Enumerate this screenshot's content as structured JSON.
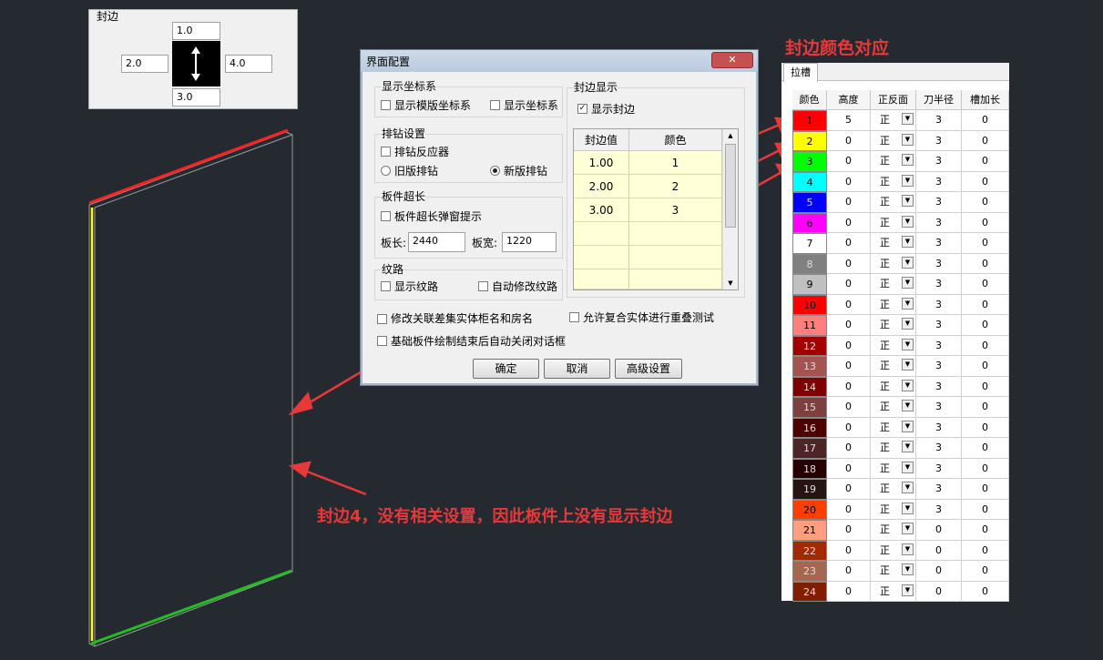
{
  "edge_panel": {
    "title": "封边",
    "top": "1.0",
    "left": "2.0",
    "right": "4.0",
    "bottom": "3.0"
  },
  "dialog": {
    "title": "界面配置",
    "close_label": "✕",
    "coord_group": "显示坐标系",
    "coord_opt1": "显示模版坐标系",
    "coord_opt2": "显示坐标系",
    "drill_group": "排钻设置",
    "drill_reactor": "排钻反应器",
    "drill_old": "旧版排钻",
    "drill_new": "新版排钻",
    "overlen_group": "板件超长",
    "overlen_popup": "板件超长弹窗提示",
    "len_label": "板长:",
    "len_value": "2440",
    "width_label": "板宽:",
    "width_value": "1220",
    "grain_group": "纹路",
    "grain_show": "显示纹路",
    "grain_auto": "自动修改纹路",
    "edge_group": "封边显示",
    "edge_show": "显示封边",
    "edge_table": {
      "headers": [
        "封边值",
        "颜色"
      ],
      "rows": [
        [
          "1.00",
          "1"
        ],
        [
          "2.00",
          "2"
        ],
        [
          "3.00",
          "3"
        ]
      ]
    },
    "opt_rename": "修改关联差集实体柜名和房名",
    "opt_overlap": "允许复合实体进行重叠测试",
    "opt_autoclose": "基础板件绘制结束后自动关闭对话框",
    "ok": "确定",
    "cancel": "取消",
    "advanced": "高级设置"
  },
  "color_panel": {
    "title": "封边颜色对应",
    "tab": "拉槽",
    "headers": [
      "颜色",
      "高度",
      "正反面",
      "刀半径",
      "槽加长"
    ],
    "face_value": "正",
    "rows": [
      {
        "id": "1",
        "color": "#ff0000",
        "height": "5",
        "radius": "3",
        "ext": "0"
      },
      {
        "id": "2",
        "color": "#ffff00",
        "height": "0",
        "radius": "3",
        "ext": "0"
      },
      {
        "id": "3",
        "color": "#00ff00",
        "height": "0",
        "radius": "3",
        "ext": "0"
      },
      {
        "id": "4",
        "color": "#00ffff",
        "height": "0",
        "radius": "3",
        "ext": "0"
      },
      {
        "id": "5",
        "color": "#0000ff",
        "height": "0",
        "radius": "3",
        "ext": "0"
      },
      {
        "id": "6",
        "color": "#ff00ff",
        "height": "0",
        "radius": "3",
        "ext": "0"
      },
      {
        "id": "7",
        "color": "#ffffff",
        "height": "0",
        "radius": "3",
        "ext": "0"
      },
      {
        "id": "8",
        "color": "#808080",
        "height": "0",
        "radius": "3",
        "ext": "0"
      },
      {
        "id": "9",
        "color": "#c0c0c0",
        "height": "0",
        "radius": "3",
        "ext": "0"
      },
      {
        "id": "10",
        "color": "#ff0000",
        "height": "0",
        "radius": "3",
        "ext": "0"
      },
      {
        "id": "11",
        "color": "#ff7f7f",
        "height": "0",
        "radius": "3",
        "ext": "0"
      },
      {
        "id": "12",
        "color": "#a50000",
        "height": "0",
        "radius": "3",
        "ext": "0"
      },
      {
        "id": "13",
        "color": "#a55252",
        "height": "0",
        "radius": "3",
        "ext": "0"
      },
      {
        "id": "14",
        "color": "#7f0000",
        "height": "0",
        "radius": "3",
        "ext": "0"
      },
      {
        "id": "15",
        "color": "#7f3f3f",
        "height": "0",
        "radius": "3",
        "ext": "0"
      },
      {
        "id": "16",
        "color": "#4c0000",
        "height": "0",
        "radius": "3",
        "ext": "0"
      },
      {
        "id": "17",
        "color": "#4c2626",
        "height": "0",
        "radius": "3",
        "ext": "0"
      },
      {
        "id": "18",
        "color": "#260000",
        "height": "0",
        "radius": "3",
        "ext": "0"
      },
      {
        "id": "19",
        "color": "#261313",
        "height": "0",
        "radius": "3",
        "ext": "0"
      },
      {
        "id": "20",
        "color": "#ff3f00",
        "height": "0",
        "radius": "3",
        "ext": "0"
      },
      {
        "id": "21",
        "color": "#ff9f7f",
        "height": "0",
        "radius": "0",
        "ext": "0"
      },
      {
        "id": "22",
        "color": "#a52900",
        "height": "0",
        "radius": "0",
        "ext": "0"
      },
      {
        "id": "23",
        "color": "#a56752",
        "height": "0",
        "radius": "0",
        "ext": "0"
      },
      {
        "id": "24",
        "color": "#7f1f00",
        "height": "0",
        "radius": "0",
        "ext": "0"
      }
    ]
  },
  "annotation": "封边4，没有相关设置，因此板件上没有显示封边",
  "colors": {
    "annotation_red": "#e8383a",
    "edge_red": "#ff2020",
    "edge_yellow": "#ffff00",
    "edge_green": "#20c020"
  }
}
